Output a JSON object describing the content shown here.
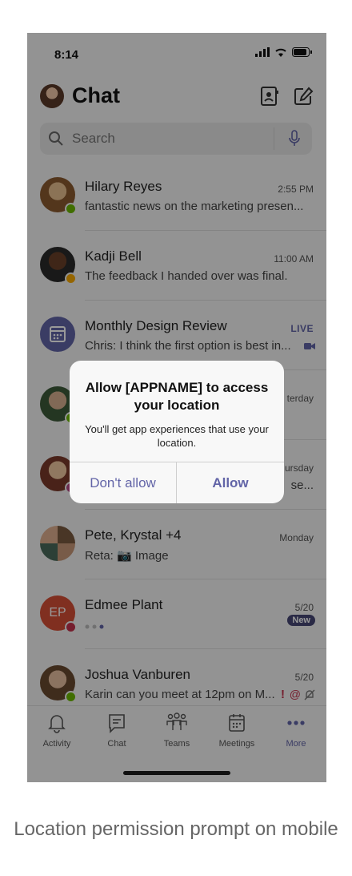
{
  "status": {
    "time": "8:14"
  },
  "header": {
    "title": "Chat"
  },
  "search": {
    "placeholder": "Search"
  },
  "chats": [
    {
      "name": "Hilary Reyes",
      "message": "fantastic news on the marketing presen...",
      "time": "2:55 PM",
      "presence": "available"
    },
    {
      "name": "Kadji Bell",
      "message": "The feedback I handed over was final.",
      "time": "11:00 AM",
      "presence": "away"
    },
    {
      "name": "Monthly Design Review",
      "message": "Chris: I think the first option is best in...",
      "badge": "LIVE"
    },
    {
      "name": "",
      "message": "",
      "time": "terday"
    },
    {
      "name": "",
      "message": "se...",
      "time": "ursday"
    },
    {
      "name": "Pete, Krystal +4",
      "message": "Reta: 📷 Image",
      "time": "Monday"
    },
    {
      "name": "Edmee Plant",
      "initials": "EP",
      "message": "",
      "time": "5/20",
      "badge": "New",
      "presence": "busy"
    },
    {
      "name": "Joshua Vanburen",
      "message": "Karin can you meet at 12pm on M...",
      "time": "5/20",
      "presence": "available"
    }
  ],
  "tabs": [
    {
      "label": "Activity",
      "icon": "bell-icon"
    },
    {
      "label": "Chat",
      "icon": "chat-icon"
    },
    {
      "label": "Teams",
      "icon": "teams-icon"
    },
    {
      "label": "Meetings",
      "icon": "calendar-icon"
    },
    {
      "label": "More",
      "icon": "more-icon",
      "active": true
    }
  ],
  "dialog": {
    "title": "Allow [APPNAME] to access your location",
    "message": "You'll get app experiences that use your location.",
    "deny_label": "Don't allow",
    "allow_label": "Allow"
  },
  "caption": "Location permission prompt on mobile",
  "colors": {
    "accent": "#6264a7",
    "available": "#6bb700",
    "away": "#f8a800",
    "busy": "#c4314b"
  }
}
